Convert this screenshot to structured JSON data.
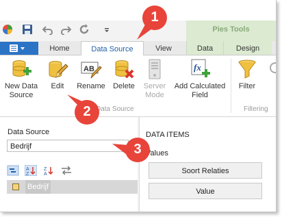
{
  "contextual_group": {
    "title": "Pies Tools"
  },
  "tabs": [
    {
      "label": "Home"
    },
    {
      "label": "Data Source"
    },
    {
      "label": "View"
    },
    {
      "label": "Data"
    },
    {
      "label": "Design"
    }
  ],
  "ribbon": {
    "buttons": [
      {
        "label": "New Data\nSource",
        "icon": "database-add-icon"
      },
      {
        "label": "Edit",
        "icon": "pencil-icon"
      },
      {
        "label": "Rename",
        "icon": "rename-icon"
      },
      {
        "label": "Delete",
        "icon": "database-delete-icon"
      },
      {
        "label": "Server\nMode",
        "icon": "server-icon"
      },
      {
        "label": "Add Calculated\nField",
        "icon": "function-add-icon"
      },
      {
        "label": "Filter",
        "icon": "funnel-icon"
      }
    ],
    "groups": [
      {
        "label": "Data Source"
      },
      {
        "label": "Filtering"
      }
    ]
  },
  "left_panel": {
    "data_source_label": "Data Source",
    "data_source_value": "Bedrijf",
    "tree": [
      {
        "label": "Bedrijf"
      }
    ]
  },
  "right_panel": {
    "title": "DATA ITEMS",
    "values_label": "Values",
    "items": [
      {
        "label": "Soort Relaties"
      },
      {
        "label": "Value"
      }
    ]
  },
  "callouts": [
    "1",
    "2",
    "3"
  ],
  "colors": {
    "accent": "#1f5fa8",
    "callout": "#e8443a",
    "context_tab": "#dbead1",
    "file_button": "#2b73c5"
  }
}
